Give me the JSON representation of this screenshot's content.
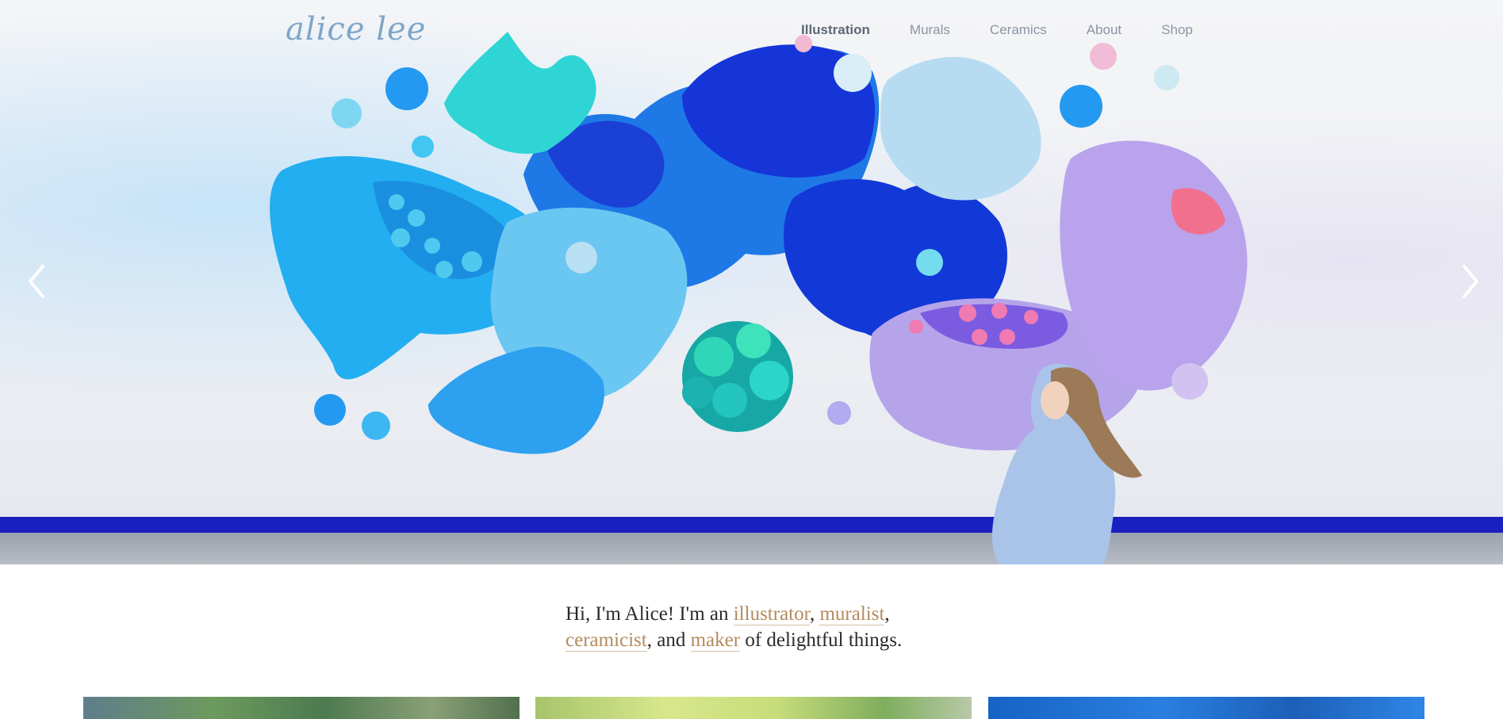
{
  "header": {
    "logo": "alice lee",
    "nav": [
      {
        "label": "Illustration",
        "active": true
      },
      {
        "label": "Murals",
        "active": false
      },
      {
        "label": "Ceramics",
        "active": false
      },
      {
        "label": "About",
        "active": false
      },
      {
        "label": "Shop",
        "active": false
      }
    ]
  },
  "hero": {
    "prev_icon": "chevron-left-icon",
    "next_icon": "chevron-right-icon"
  },
  "intro": {
    "greeting": "Hi, I'm Alice! I'm an ",
    "link_illustrator": "illustrator",
    "sep1": ", ",
    "link_muralist": "muralist",
    "sep2": ",",
    "link_ceramicist": "ceramicist",
    "sep3": ", and ",
    "link_maker": "maker",
    "tail": " of delightful things."
  },
  "colors": {
    "link": "#b48a5c",
    "nav_active": "#5c6875",
    "nav": "#8a96a3",
    "logo": "#7fa6c9",
    "baseboard": "#1a1fc0"
  }
}
